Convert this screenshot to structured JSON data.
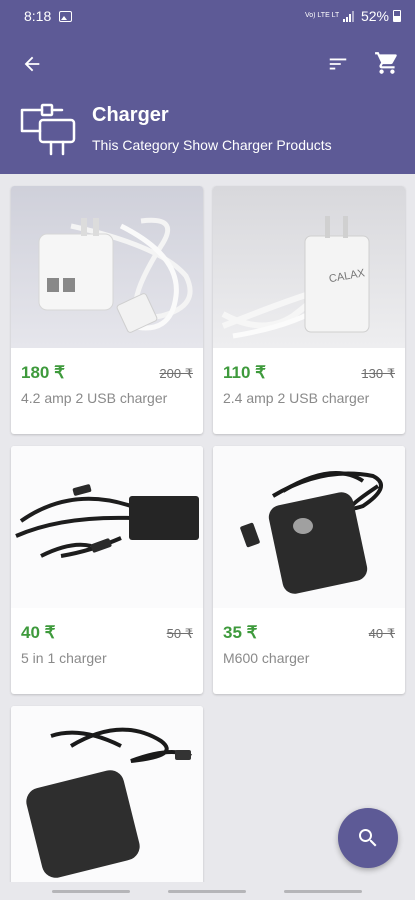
{
  "status": {
    "time": "8:18",
    "network": "Vo) LTE LTE1",
    "battery": "52%"
  },
  "header": {
    "title": "Charger",
    "subtitle": "This Category Show Charger Products"
  },
  "products": [
    {
      "price": "180 ₹",
      "old_price": "200 ₹",
      "name": "4.2 amp 2 USB charger"
    },
    {
      "price": "110 ₹",
      "old_price": "130 ₹",
      "name": "2.4 amp 2 USB charger"
    },
    {
      "price": "40 ₹",
      "old_price": "50 ₹",
      "name": "5 in 1 charger"
    },
    {
      "price": "35 ₹",
      "old_price": "40 ₹",
      "name": "M600 charger"
    },
    {
      "price": "",
      "old_price": "",
      "name": ""
    }
  ],
  "image_text": {
    "brand_1": "CALAX"
  },
  "colors": {
    "primary": "#5d5a96",
    "price": "#3e9a3c"
  },
  "icons": {
    "back": "arrow-left",
    "sort": "sort",
    "cart": "cart",
    "category": "charger",
    "fab": "search"
  }
}
